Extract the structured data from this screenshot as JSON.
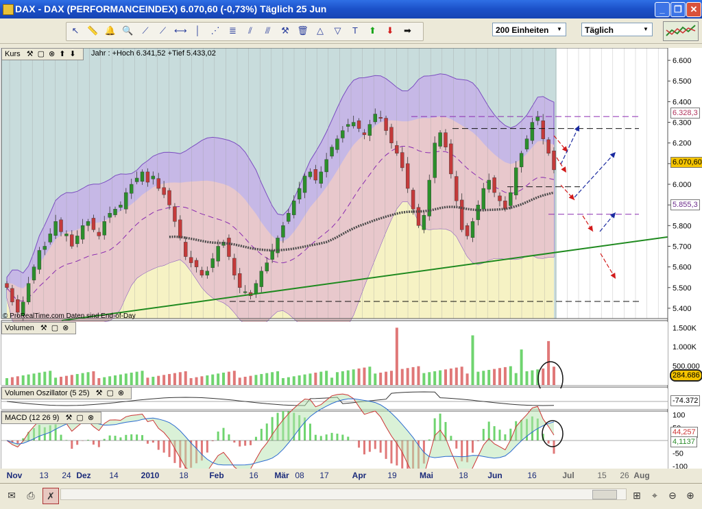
{
  "window": {
    "title": "DAX - DAX (PERFORMANCEINDEX)     6.070,60 (-0,73%)     Täglich  25 Jun",
    "minimize": "_",
    "restore": "❐",
    "close": "✕"
  },
  "toolbar": {
    "units_select": "200 Einheiten",
    "period_select": "Täglich",
    "tools": [
      "cursor-icon",
      "ruler-icon",
      "alarm-icon",
      "zoom-icon",
      "line-icon",
      "line2-icon",
      "hline-icon",
      "vline-icon",
      "fan-icon",
      "fib-icon",
      "channel-icon",
      "parallel-icon",
      "wrench-icon",
      "trash-icon",
      "triangle-icon",
      "triangle2-icon",
      "text-icon",
      "up-arrow-icon",
      "down-arrow-icon",
      "right-arrow-icon"
    ]
  },
  "panels": {
    "price": {
      "label": "Kurs",
      "info": "Jahr : +Hoch 6.341,52 +Tief 5.433,02",
      "copyright": "© ProRealTime.com  Daten sind End-of-Day"
    },
    "volume": {
      "label": "Volumen"
    },
    "vol_osc": {
      "label": "Volumen Oszillator (5 25)"
    },
    "macd": {
      "label": "MACD (12 26 9)"
    }
  },
  "badges": {
    "last_price": "6.070,60",
    "level_high": "6.328,3",
    "level_low": "5.855,3",
    "volume": "284.686",
    "vol_osc": "-74.372",
    "macd_line": "44,257",
    "macd_signal": "4,1137"
  },
  "colors": {
    "bg_upper": "#c8dcdc",
    "band_outer": "#c6b8e6",
    "band_inner": "#e8c8cc",
    "yellow_fill": "#f6f2c4",
    "up_candle": "#2b8f2b",
    "down_candle": "#c43a3a",
    "trendline": "#1f8a1f",
    "ma_dots": "#4a4a4a",
    "vol_up": "#6fd46f",
    "vol_down": "#e07878"
  },
  "chart_data": [
    {
      "type": "candlestick",
      "panel": "Kurs",
      "x_ticks": [
        "Nov",
        "13",
        "24",
        "Dez",
        "14",
        "2010",
        "18",
        "Feb",
        "16",
        "Mär",
        "08",
        "17",
        "Apr",
        "19",
        "Mai",
        "18",
        "Jun",
        "16",
        "Jul",
        "15",
        "26",
        "Aug"
      ],
      "y_ticks": [
        "6.600",
        "6.500",
        "6.400",
        "6.300",
        "6.200",
        "6.100",
        "6.000",
        "5.900",
        "5.800",
        "5.700",
        "5.600",
        "5.500",
        "5.400"
      ],
      "ylim": [
        5350,
        6660
      ],
      "close_series": [
        5500,
        5430,
        5380,
        5430,
        5520,
        5600,
        5680,
        5700,
        5760,
        5820,
        5770,
        5760,
        5700,
        5750,
        5800,
        5820,
        5780,
        5750,
        5820,
        5860,
        5880,
        5900,
        5960,
        6000,
        6030,
        6060,
        6010,
        6040,
        5980,
        5950,
        5900,
        5820,
        5740,
        5650,
        5620,
        5600,
        5560,
        5580,
        5640,
        5700,
        5720,
        5650,
        5560,
        5500,
        5480,
        5460,
        5520,
        5580,
        5620,
        5680,
        5740,
        5800,
        5860,
        5920,
        5980,
        6040,
        6060,
        6020,
        6060,
        6120,
        6180,
        6220,
        6260,
        6290,
        6300,
        6270,
        6240,
        6290,
        6340,
        6320,
        6260,
        6200,
        6150,
        6080,
        5980,
        5880,
        5800,
        5850,
        6020,
        6200,
        6250,
        6180,
        6050,
        5920,
        5780,
        5750,
        5820,
        5900,
        5980,
        6020,
        5960,
        5920,
        5880,
        5960,
        6080,
        6150,
        6220,
        6300,
        6328,
        6220,
        6150,
        6070
      ],
      "close_x_ticks_note": "daily closes from early Nov to 25 Jun"
    },
    {
      "type": "bar",
      "panel": "Volumen",
      "y_ticks": [
        "1.500K",
        "1.000K",
        "500.000"
      ],
      "ylim": [
        0,
        1650000
      ]
    },
    {
      "type": "area",
      "panel": "Volumen Oszillator (5 25)",
      "ylim": [
        -200000,
        200000
      ]
    },
    {
      "type": "line",
      "panel": "MACD (12 26 9)",
      "y_ticks": [
        "100",
        "50",
        "0",
        "-50",
        "-100"
      ],
      "ylim": [
        -110,
        110
      ]
    }
  ]
}
